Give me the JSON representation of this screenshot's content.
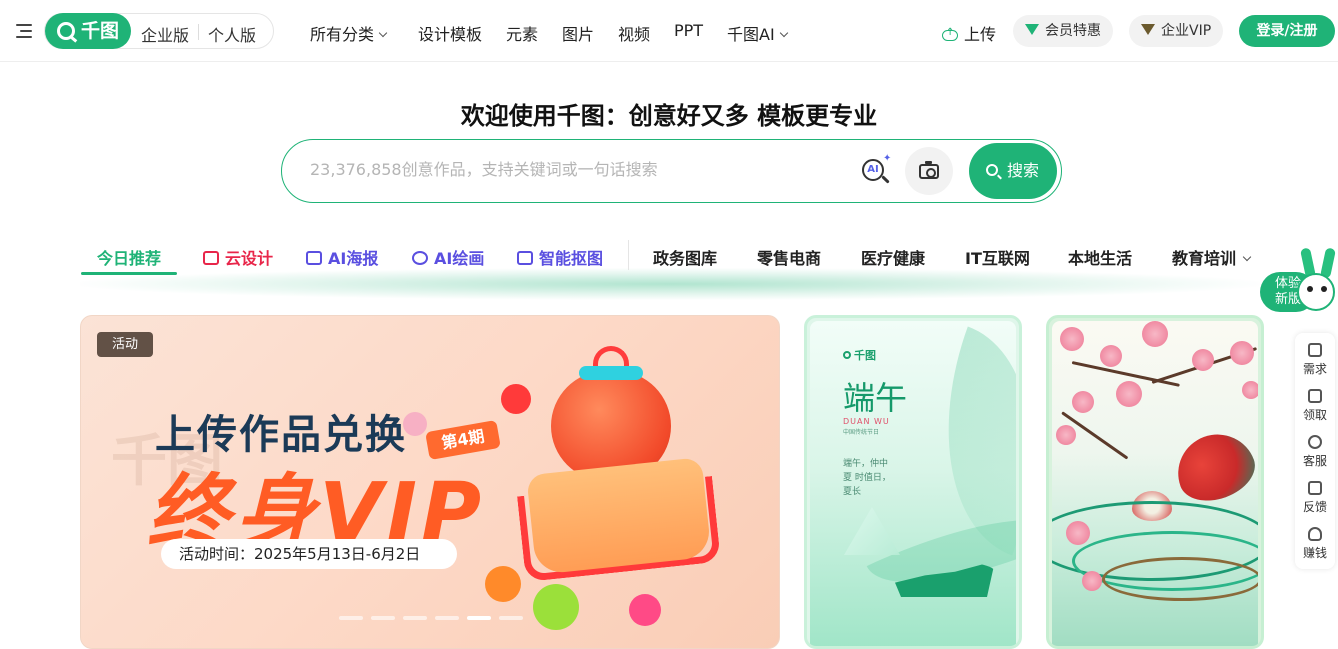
{
  "header": {
    "brand": "千图",
    "editions": [
      "企业版",
      "个人版"
    ],
    "nav": [
      {
        "label": "所有分类",
        "dropdown": true
      },
      {
        "label": "设计模板",
        "dropdown": false
      },
      {
        "label": "元素",
        "dropdown": false
      },
      {
        "label": "图片",
        "dropdown": false
      },
      {
        "label": "视频",
        "dropdown": false
      },
      {
        "label": "PPT",
        "dropdown": false
      },
      {
        "label": "千图AI",
        "dropdown": true
      }
    ],
    "upload_label": "上传",
    "member_label": "会员特惠",
    "enterprise_vip_label": "企业VIP",
    "login_label": "登录/注册",
    "accent_color": "#1fb377"
  },
  "hero": {
    "headline": "欢迎使用千图：创意好又多 模板更专业",
    "search_placeholder": "23,376,858创意作品，支持关键词或一句话搜索",
    "search_button": "搜索",
    "ai_badge": "AI"
  },
  "tabs": {
    "active": "今日推荐",
    "items": [
      {
        "label": "今日推荐",
        "icon": "none",
        "color": "#1fb377"
      },
      {
        "label": "云设计",
        "icon": "gift-icon",
        "color": "#e8264a"
      },
      {
        "label": "AI海报",
        "icon": "ai-poster-icon",
        "color": "#5a4fe0"
      },
      {
        "label": "AI绘画",
        "icon": "ai-paint-icon",
        "color": "#5a4fe0"
      },
      {
        "label": "智能抠图",
        "icon": "cutout-icon",
        "color": "#5a4fe0"
      },
      {
        "label": "政务图库",
        "icon": "none",
        "color": "#222222"
      },
      {
        "label": "零售电商",
        "icon": "none",
        "color": "#222222"
      },
      {
        "label": "医疗健康",
        "icon": "none",
        "color": "#222222"
      },
      {
        "label": "IT互联网",
        "icon": "none",
        "color": "#222222"
      },
      {
        "label": "本地生活",
        "icon": "none",
        "color": "#222222"
      },
      {
        "label": "教育培训",
        "icon": "chevron-down-icon",
        "color": "#222222"
      }
    ]
  },
  "badge": {
    "new_version": [
      "体验",
      "新版"
    ]
  },
  "side_tools": [
    "需求",
    "领取",
    "客服",
    "反馈",
    "赚钱"
  ],
  "banner": {
    "tag": "活动",
    "title_line1": "上传作品兑换",
    "issue": "第4期",
    "title_line2": "终身VIP",
    "date": "活动时间：2025年5月13日-6月2日",
    "watermark": "千图",
    "slide_count": 6,
    "active_slide": 5
  },
  "cards": {
    "duanwu": {
      "logo": "千图",
      "title": "端午",
      "subtitle_en": "DUAN WU",
      "subtitle_cn": "中国传统节日",
      "poem": "端午，仲中夏 时值日，夏长"
    },
    "koi": {}
  }
}
